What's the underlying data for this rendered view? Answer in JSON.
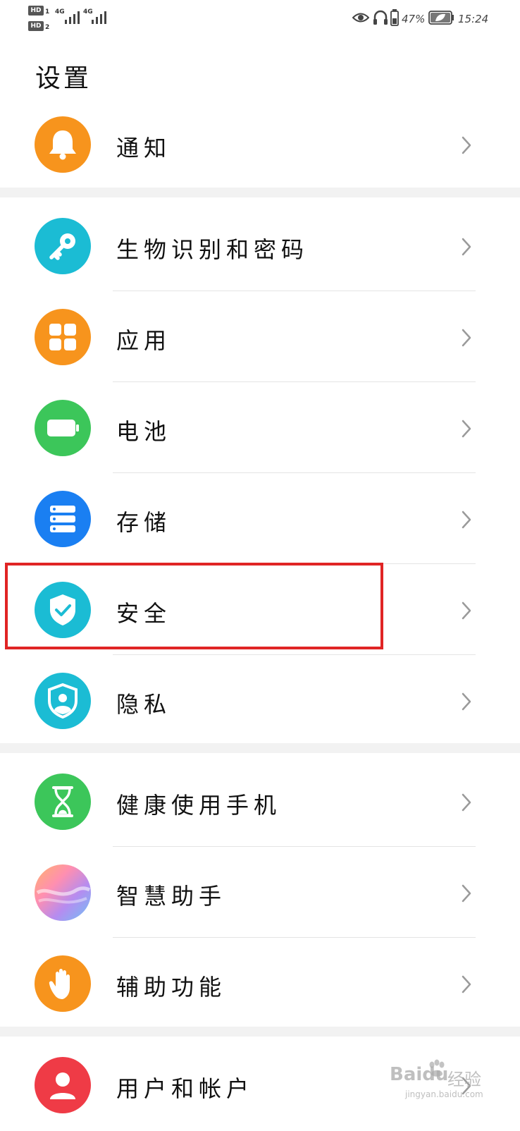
{
  "status_bar": {
    "sim1_badge": "HD",
    "sim1_num": "1",
    "sim2_badge": "HD",
    "sim2_num": "2",
    "net1": "4G",
    "net2": "4G",
    "battery_percent": "47%",
    "time": "15:24",
    "icons": [
      "eye-icon",
      "headphones-icon",
      "battery-icon",
      "leaf-battery-saver-icon"
    ]
  },
  "page": {
    "title": "设置"
  },
  "items": [
    {
      "label": "通知",
      "icon": "bell-icon",
      "color": "#f7941d"
    },
    {
      "label": "生物识别和密码",
      "icon": "key-icon",
      "color": "#1bbcd4"
    },
    {
      "label": "应用",
      "icon": "apps-grid-icon",
      "color": "#f7941d"
    },
    {
      "label": "电池",
      "icon": "battery-icon",
      "color": "#3cc65a"
    },
    {
      "label": "存储",
      "icon": "storage-icon",
      "color": "#1a7ff2"
    },
    {
      "label": "安全",
      "icon": "shield-check-icon",
      "color": "#1bbcd4"
    },
    {
      "label": "隐私",
      "icon": "privacy-shield-icon",
      "color": "#1bbcd4"
    },
    {
      "label": "健康使用手机",
      "icon": "hourglass-icon",
      "color": "#3cc65a"
    },
    {
      "label": "智慧助手",
      "icon": "assistant-gradient-icon",
      "color": "#c9a2e0"
    },
    {
      "label": "辅助功能",
      "icon": "hand-icon",
      "color": "#f7941d"
    },
    {
      "label": "用户和帐户",
      "icon": "user-icon",
      "color": "#ef3b46"
    }
  ],
  "watermark": {
    "brand": "Baidu",
    "cn": "经验",
    "url": "jingyan.baidu.com"
  },
  "colors": {
    "highlight": "#e02424",
    "chevron": "#9a9a9a"
  }
}
